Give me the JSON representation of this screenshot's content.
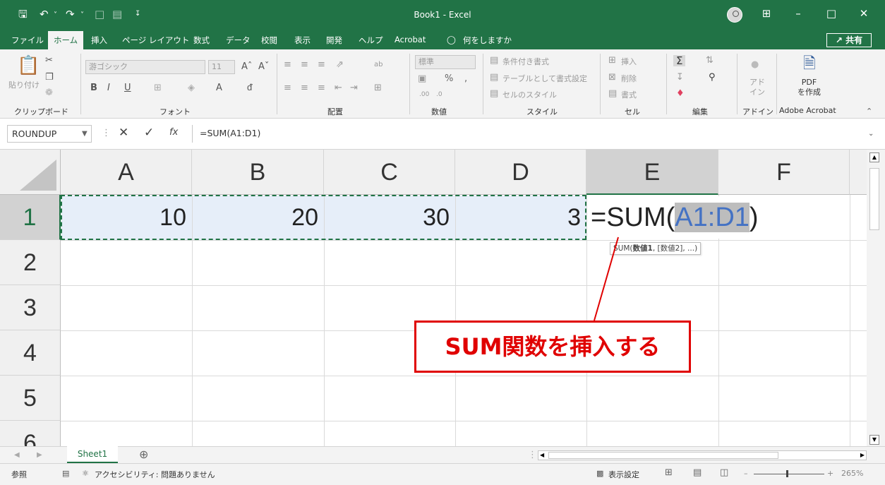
{
  "window": {
    "title": "Book1  -  Excel"
  },
  "menu": {
    "tabs": [
      "ファイル",
      "ホーム",
      "挿入",
      "ページ レイアウト",
      "数式",
      "データ",
      "校閲",
      "表示",
      "開発",
      "ヘルプ",
      "Acrobat",
      "何をしますか"
    ],
    "active": "ホーム",
    "share": "共有"
  },
  "ribbon": {
    "groups": [
      "クリップボード",
      "フォント",
      "配置",
      "数値",
      "スタイル",
      "セル",
      "編集",
      "アドイン",
      "Adobe Acrobat"
    ],
    "paste": "貼り付け",
    "font_name": "游ゴシック",
    "font_size": "11",
    "number_format": "標準",
    "styles": [
      "条件付き書式",
      "テーブルとして書式設定",
      "セルのスタイル"
    ],
    "cells": [
      "挿入",
      "削除",
      "書式"
    ],
    "addin": "アド\nイン",
    "pdf": "PDF\nを作成"
  },
  "formula_bar": {
    "name_box": "ROUNDUP",
    "formula": "=SUM(A1:D1)"
  },
  "grid": {
    "columns": [
      "A",
      "B",
      "C",
      "D",
      "E",
      "F"
    ],
    "rows": [
      "1",
      "2",
      "3",
      "4",
      "5",
      "6"
    ],
    "cells": {
      "A1": "10",
      "B1": "20",
      "C1": "30",
      "D1": "3"
    },
    "edit": {
      "prefix": "=SUM(",
      "ref": "A1:D1",
      "suffix": ")"
    },
    "tooltip": {
      "fn": "SUM(",
      "arg1": "数値1",
      "rest": ", [数値2], ...)"
    }
  },
  "sheets": {
    "tabs": [
      "Sheet1"
    ]
  },
  "status": {
    "mode": "参照",
    "accessibility": "アクセシビリティ: 問題ありません",
    "display_settings": "表示設定",
    "zoom": "265%"
  },
  "annotation": {
    "text": "SUM関数を挿入する"
  },
  "colors": {
    "excel_green": "#217346",
    "callout_red": "#e00000",
    "ref_blue": "#4472c4"
  }
}
